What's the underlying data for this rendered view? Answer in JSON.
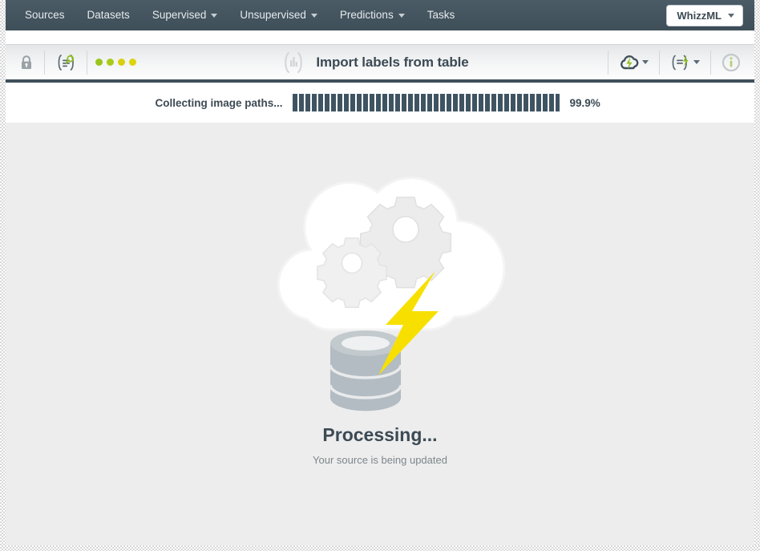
{
  "nav": {
    "items": [
      {
        "label": "Sources",
        "name": "nav-item-sources",
        "dropdown": false
      },
      {
        "label": "Datasets",
        "name": "nav-item-datasets",
        "dropdown": false
      },
      {
        "label": "Supervised",
        "name": "nav-item-supervised",
        "dropdown": true
      },
      {
        "label": "Unsupervised",
        "name": "nav-item-unsupervised",
        "dropdown": true
      },
      {
        "label": "Predictions",
        "name": "nav-item-predictions",
        "dropdown": true
      },
      {
        "label": "Tasks",
        "name": "nav-item-tasks",
        "dropdown": false
      }
    ],
    "account_button": {
      "label": "WhizzML"
    }
  },
  "toolbar": {
    "title": "Import labels from table",
    "title_icon": "source-bars-icon",
    "left_icons": [
      {
        "name": "lock-icon",
        "title": "Privacy"
      },
      {
        "name": "source-search-icon",
        "title": "Inspect source"
      }
    ],
    "status_dots": [
      {
        "name": "status-dot-1",
        "color": "#9ac61c"
      },
      {
        "name": "status-dot-2",
        "color": "#a9cb17"
      },
      {
        "name": "status-dot-3",
        "color": "#d8cf10"
      },
      {
        "name": "status-dot-4",
        "color": "#dcd40f"
      }
    ],
    "right_icons": [
      {
        "name": "cloud-lightning-icon",
        "has_dropdown": true
      },
      {
        "name": "source-lightning-icon",
        "has_dropdown": true
      },
      {
        "name": "info-icon",
        "has_dropdown": false
      }
    ]
  },
  "progress": {
    "label": "Collecting image paths...",
    "percent_text": "99.9%",
    "percent_value": 99.9
  },
  "content": {
    "illustration": "cloud-gears-database-lightning-illustration",
    "title": "Processing...",
    "subtitle": "Your source is being updated"
  },
  "colors": {
    "navbar": "#44545f",
    "accent_dark": "#3f4f5a",
    "accent_green": "#9ac61c",
    "lightning_yellow": "#f7e000",
    "database_gray": "#b3bcc2",
    "page_bg": "#ededed"
  }
}
